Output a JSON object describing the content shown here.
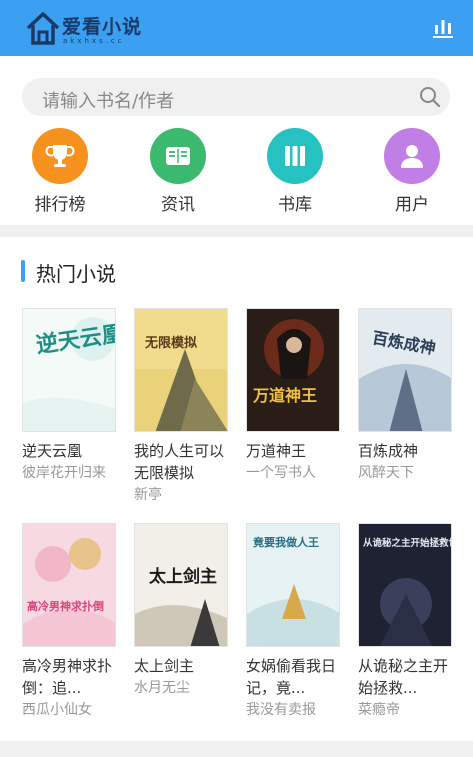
{
  "brand": {
    "logo_text": "爱看小说",
    "logo_sub": "akxhxs.cc"
  },
  "search": {
    "placeholder": "请输入书名/作者"
  },
  "nav": [
    {
      "label": "排行榜",
      "icon": "trophy-icon",
      "color": "#f7921e"
    },
    {
      "label": "资讯",
      "icon": "news-icon",
      "color": "#3bba6f"
    },
    {
      "label": "书库",
      "icon": "library-icon",
      "color": "#26c2c2"
    },
    {
      "label": "用户",
      "icon": "user-icon",
      "color": "#c07ee6"
    }
  ],
  "hot": {
    "title": "热门小说",
    "books": [
      {
        "title": "逆天云凰",
        "author": "彼岸花开归来",
        "cover_text": "逆天云凰"
      },
      {
        "title": "我的人生可以无限模拟",
        "author": "新亭",
        "cover_text": "无限模拟"
      },
      {
        "title": "万道神王",
        "author": "一个写书人",
        "cover_text": "万道神王"
      },
      {
        "title": "百炼成神",
        "author": "风醉天下",
        "cover_text": "百炼成神"
      },
      {
        "title": "高冷男神求扑倒：追...",
        "author": "西瓜小仙女",
        "cover_text": "高冷男神求扑倒"
      },
      {
        "title": "太上剑主",
        "author": "水月无尘",
        "cover_text": "太上剑主"
      },
      {
        "title": "女娲偷看我日记，竟...",
        "author": "我没有卖报",
        "cover_text": "竟要我做人王"
      },
      {
        "title": "从诡秘之主开始拯救...",
        "author": "菜瘾帝",
        "cover_text": "从诡秘之主开始拯救世界"
      }
    ]
  },
  "colors": {
    "header": "#3b9ff2",
    "accent": "#3b9ff2"
  }
}
